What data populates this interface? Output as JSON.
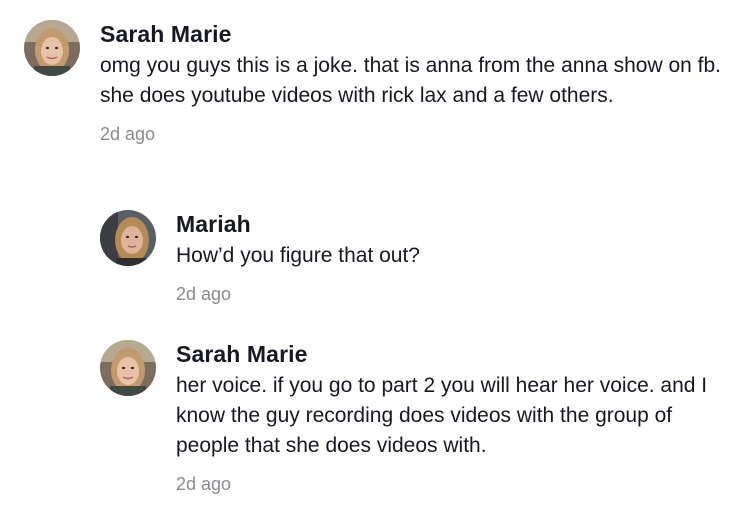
{
  "comments": [
    {
      "author": "Sarah Marie",
      "text": "omg you guys this is a joke. that is anna from the anna show on fb. she does youtube videos with rick lax and a few others.",
      "time": "2d ago",
      "avatar_icon": "profile-photo-avatar"
    },
    {
      "author": "Mariah",
      "text": "How’d you figure that out?",
      "time": "2d ago",
      "avatar_icon": "profile-photo-avatar"
    },
    {
      "author": "Sarah Marie",
      "text": "her voice. if you go to part 2 you will hear her voice. and I know the guy recording does videos with the group of people that she does videos with.",
      "time": "2d ago",
      "avatar_icon": "profile-photo-avatar"
    }
  ]
}
